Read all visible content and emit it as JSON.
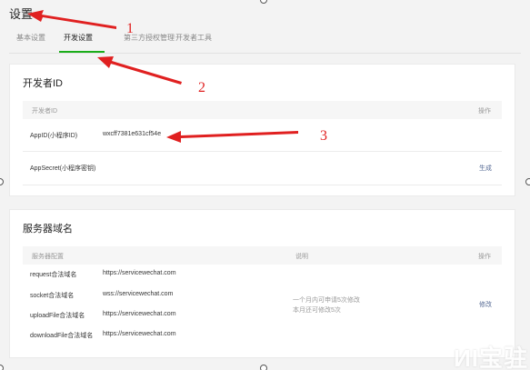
{
  "page": {
    "title": "设置"
  },
  "tabs": [
    {
      "label": "基本设置"
    },
    {
      "label": "开发设置"
    },
    {
      "label": "第三方授权管理"
    },
    {
      "label": "开发者工具"
    }
  ],
  "developer_card": {
    "title": "开发者ID",
    "headers": {
      "name": "开发者ID",
      "action": "操作"
    },
    "rows": [
      {
        "name": "AppID(小程序ID)",
        "value": "wxcff7381e631cf54e",
        "action": ""
      },
      {
        "name": "AppSecret(小程序密钥)",
        "value": "",
        "action": "生成"
      }
    ]
  },
  "server_card": {
    "title": "服务器域名",
    "headers": {
      "config": "服务器配置",
      "desc": "说明",
      "action": "操作"
    },
    "rows": [
      {
        "name": "request合法域名",
        "value": "https://servicewechat.com"
      },
      {
        "name": "socket合法域名",
        "value": "wss://servicewechat.com"
      },
      {
        "name": "uploadFile合法域名",
        "value": "https://servicewechat.com"
      },
      {
        "name": "downloadFile合法域名",
        "value": "https://servicewechat.com"
      }
    ],
    "desc_line1": "一个月内可申请5次修改",
    "desc_line2": "本月还可修改5次",
    "action_label": "修改"
  },
  "annotations": {
    "n1": "1",
    "n2": "2",
    "n3": "3"
  },
  "colors": {
    "accent": "#1aad19",
    "arrow": "#e02020",
    "link": "#576b95"
  },
  "watermark": "ИΙ宝驻"
}
